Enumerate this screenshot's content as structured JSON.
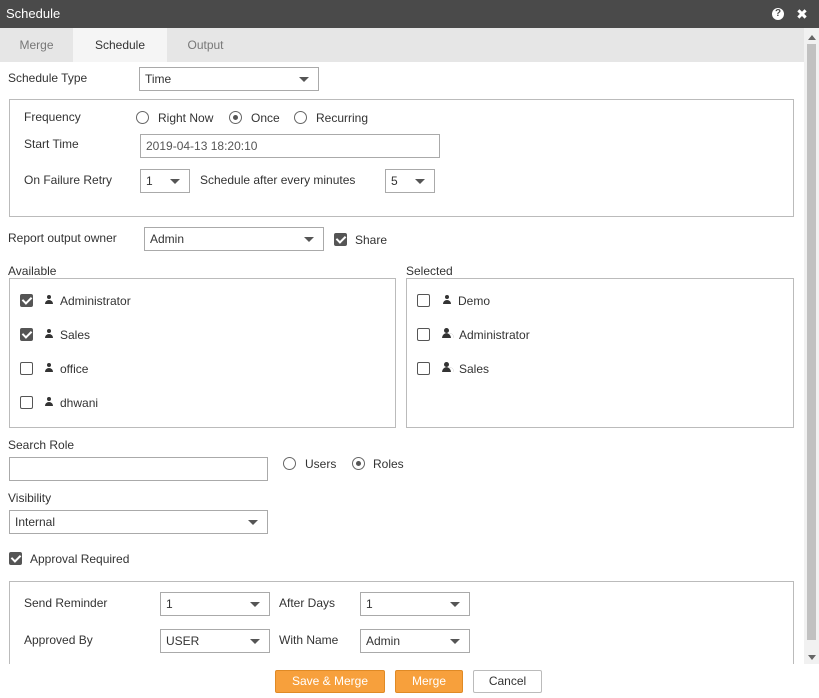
{
  "window": {
    "title": "Schedule"
  },
  "tabs": [
    {
      "label": "Merge"
    },
    {
      "label": "Schedule"
    },
    {
      "label": "Output"
    }
  ],
  "schedule_type": {
    "label": "Schedule Type",
    "value": "Time"
  },
  "frequency": {
    "label": "Frequency",
    "options": [
      "Right Now",
      "Once",
      "Recurring"
    ],
    "selected": "Once"
  },
  "start_time": {
    "label": "Start Time",
    "value": "2019-04-13 18:20:10"
  },
  "failure_retry": {
    "label": "On Failure Retry",
    "value": "1",
    "after_label": "Schedule after every minutes",
    "after_value": "5"
  },
  "owner": {
    "label": "Report output owner",
    "value": "Admin",
    "share_label": "Share",
    "share_checked": true
  },
  "available": {
    "label": "Available",
    "items": [
      {
        "name": "Administrator",
        "checked": true
      },
      {
        "name": "Sales",
        "checked": true
      },
      {
        "name": "office",
        "checked": false
      },
      {
        "name": "dhwani",
        "checked": false
      }
    ]
  },
  "selected": {
    "label": "Selected",
    "items": [
      {
        "name": "Demo",
        "type": "user"
      },
      {
        "name": "Administrator",
        "type": "role"
      },
      {
        "name": "Sales",
        "type": "role"
      }
    ]
  },
  "search_role": {
    "label": "Search Role",
    "value": "",
    "options": [
      "Users",
      "Roles"
    ],
    "selected": "Roles"
  },
  "visibility": {
    "label": "Visibility",
    "value": "Internal"
  },
  "approval": {
    "label": "Approval Required",
    "checked": true
  },
  "reminder": {
    "send_label": "Send Reminder",
    "send_value": "1",
    "after_days_label": "After Days",
    "after_days_value": "1",
    "approved_by_label": "Approved By",
    "approved_by_value": "USER",
    "with_name_label": "With Name",
    "with_name_value": "Admin"
  },
  "buttons": {
    "save_merge": "Save & Merge",
    "merge": "Merge",
    "cancel": "Cancel"
  },
  "colors": {
    "primary_button": "#f7a03c",
    "titlebar": "#4a4a4a"
  }
}
